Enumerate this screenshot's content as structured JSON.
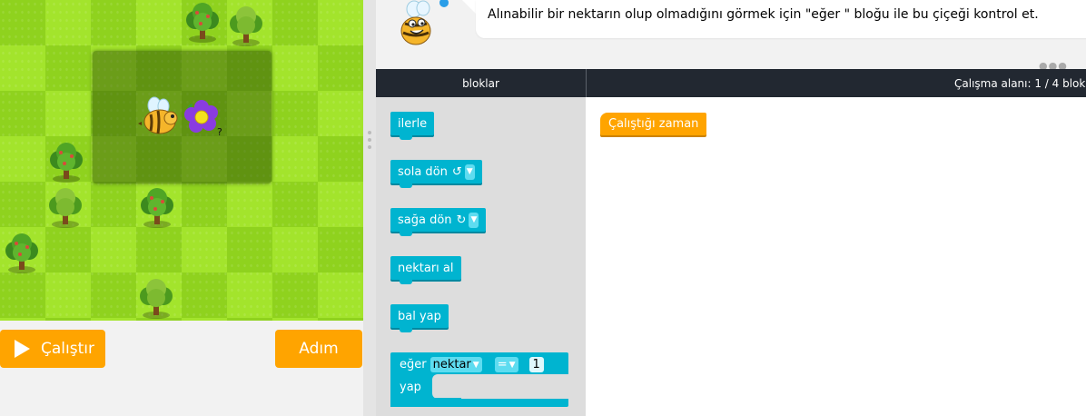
{
  "instructions": {
    "text": "Alınabilir bir nektarın olup olmadığını görmek için \"eğer \" bloğu ile bu çiçeği kontrol et."
  },
  "controls": {
    "run_label": "Çalıştır",
    "step_label": "Adım"
  },
  "header": {
    "blocks_label": "bloklar",
    "workspace_label": "Çalışma alanı: 1 / 4 blok"
  },
  "toolbox": {
    "move_forward": "ilerle",
    "turn_left": "sola dön",
    "turn_left_arrow": "↺",
    "turn_right": "sağa dön",
    "turn_right_arrow": "↻",
    "get_nectar": "nektarı al",
    "make_honey": "bal yap",
    "if_label": "eğer",
    "if_variable": "nektar",
    "if_operator": "=",
    "if_value": "1",
    "do_label": "yap"
  },
  "workspace": {
    "start_block": "Çalıştığı zaman"
  },
  "colors": {
    "accent": "#ffa400",
    "block_cyan": "#00b4d0",
    "header_dark": "#222831"
  },
  "icons": {
    "run": "play-icon",
    "flower": "flower-icon",
    "bee": "bee-icon",
    "tree": "tree-icon"
  }
}
